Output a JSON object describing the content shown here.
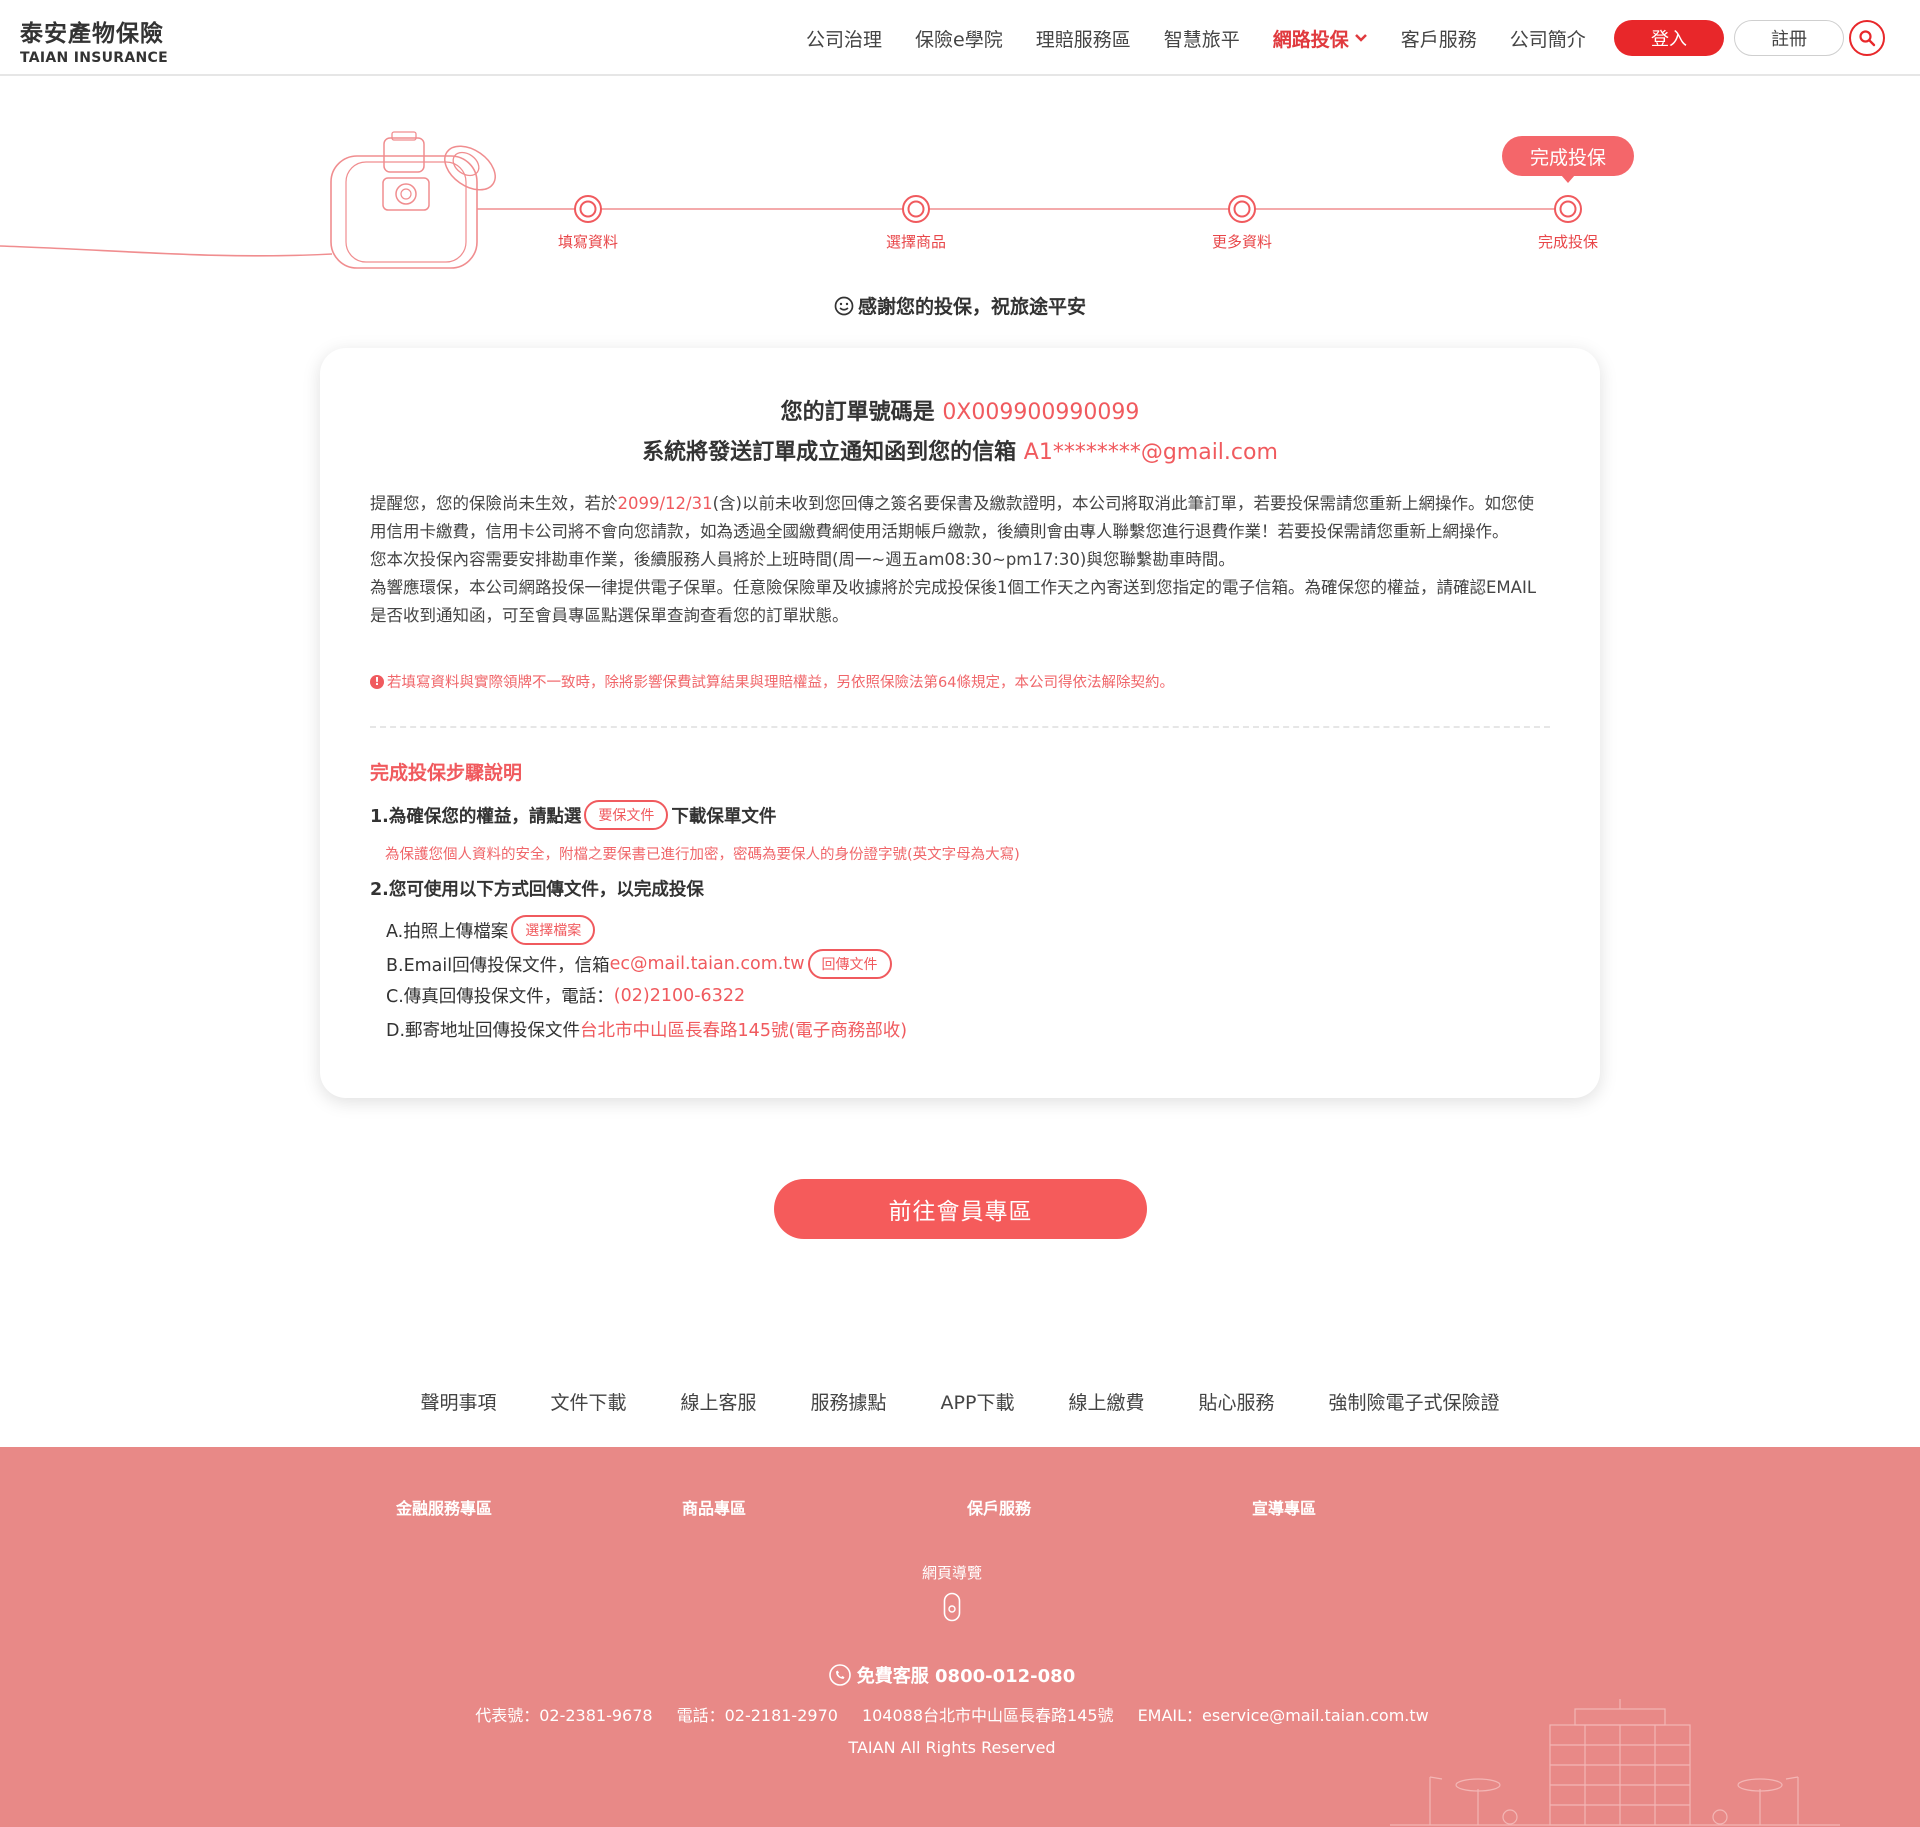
{
  "brand": {
    "name_cn": "泰安產物保險",
    "name_en": "TAIAN INSURANCE"
  },
  "nav": {
    "items": [
      "公司治理",
      "保險e學院",
      "理賠服務區",
      "智慧旅平",
      "網路投保",
      "客戶服務",
      "公司簡介"
    ],
    "active": "網路投保",
    "login": "登入",
    "register": "註冊"
  },
  "progress": {
    "steps": [
      "填寫資料",
      "選擇商品",
      "更多資料",
      "完成投保"
    ],
    "current_badge": "完成投保"
  },
  "thanks": "感謝您的投保，祝旅途平安",
  "order": {
    "number_label": "您的訂單號碼是",
    "number": "0X009900990099",
    "email_label": "系統將發送訂單成立通知函到您的信箱",
    "email": "A1********@gmail.com"
  },
  "notice": {
    "p1_a": "提醒您，您的保險尚未生效，若於",
    "p1_date": "2099/12/31",
    "p1_b": "(含)以前未收到您回傳之簽名要保書及繳款證明，本公司將取消此筆訂單，若要投保需請您重新上網操作。如您使用信用卡繳費，信用卡公司將不會向您請款，如為透過全國繳費網使用活期帳戶繳款，後續則會由專人聯繫您進行退費作業！若要投保需請您重新上網操作。",
    "p2": "您本次投保內容需要安排勘車作業，後續服務人員將於上班時間(周一~週五am08:30~pm17:30)與您聯繫勘車時間。",
    "p3": "為響應環保，本公司網路投保一律提供電子保單。任意險保險單及收據將於完成投保後1個工作天之內寄送到您指定的電子信箱。為確保您的權益，請確認EMAIL是否收到通知函，可至會員專區點選保單查詢查看您的訂單狀態。",
    "warning": "若填寫資料與實際領牌不一致時，除將影響保費試算結果與理賠權益，另依照保險法第64條規定，本公司得依法解除契約。"
  },
  "steps_section": {
    "title": "完成投保步驟說明",
    "s1_a": "1.為確保您的權益，請點選",
    "s1_btn": "要保文件",
    "s1_b": "下載保單文件",
    "s1_note": "為保護您個人資料的安全，附檔之要保書已進行加密，密碼為要保人的身份證字號(英文字母為大寫)",
    "s2": "2.您可使用以下方式回傳文件，以完成投保",
    "a_label": "A.拍照上傳檔案",
    "a_btn": "選擇檔案",
    "b_label": "B.Email回傳投保文件，信箱",
    "b_email": "ec@mail.taian.com.tw",
    "b_btn": "回傳文件",
    "c_label": "C.傳真回傳投保文件，電話：",
    "c_phone": "(02)2100-6322",
    "d_label": "D.郵寄地址回傳投保文件",
    "d_addr": "台北市中山區長春路145號(電子商務部收)"
  },
  "cta": "前往會員專區",
  "footer_links": [
    "聲明事項",
    "文件下載",
    "線上客服",
    "服務據點",
    "APP下載",
    "線上繳費",
    "貼心服務",
    "強制險電子式保險證"
  ],
  "footer": {
    "categories": [
      "金融服務專區",
      "商品專區",
      "保戶服務",
      "宣導專區"
    ],
    "sitemap": "網頁導覽",
    "hotline": "免費客服 0800-012-080",
    "contact": [
      "代表號：02-2381-9678",
      "電話：02-2181-2970",
      "104088台北市中山區長春路145號",
      "EMAIL：eservice@mail.taian.com.tw"
    ],
    "copyright": "TAIAN All Rights Reserved"
  },
  "colors": {
    "accent": "#f05a5e",
    "login": "#e8272a",
    "footer_bg": "#e88987"
  }
}
